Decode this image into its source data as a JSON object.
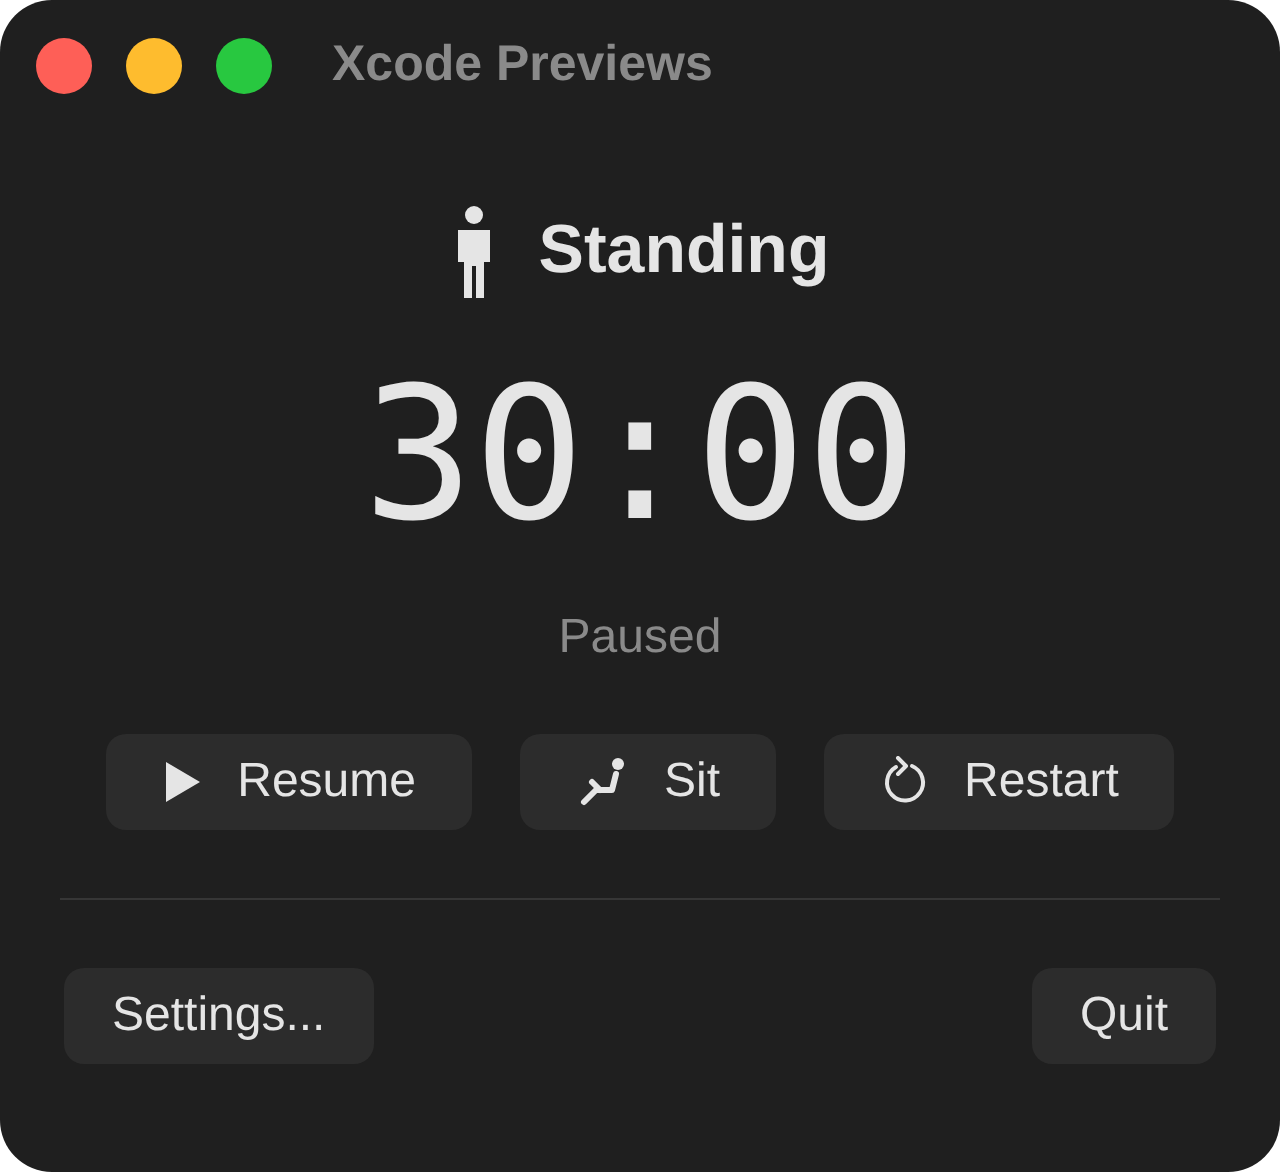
{
  "window": {
    "title": "Xcode Previews"
  },
  "status": {
    "label": "Standing"
  },
  "timer": {
    "value": "30:00",
    "state": "Paused"
  },
  "actions": [
    {
      "kind": "play",
      "label": "Resume"
    },
    {
      "kind": "sit",
      "label": "Sit"
    },
    {
      "kind": "restart",
      "label": "Restart"
    }
  ],
  "footer": {
    "left": "Settings...",
    "right": "Quit"
  }
}
